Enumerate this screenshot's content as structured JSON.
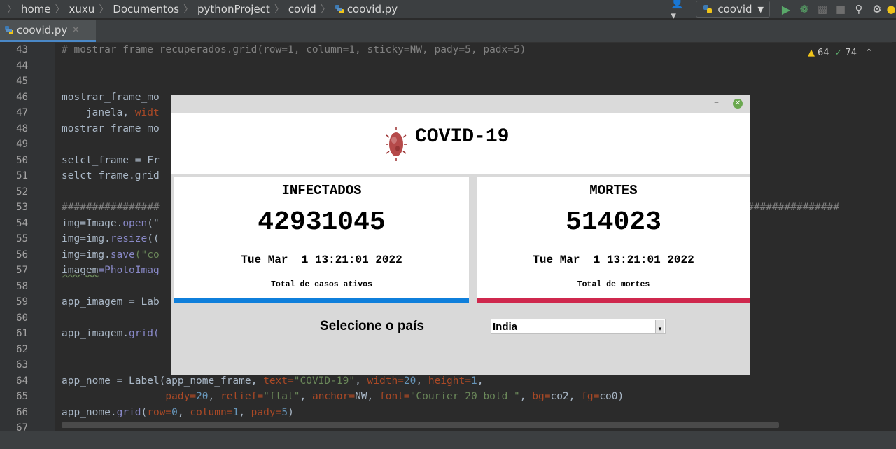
{
  "breadcrumb": [
    "home",
    "xuxu",
    "Documentos",
    "pythonProject",
    "covid",
    "coovid.py"
  ],
  "run_config": "coovid",
  "editor_tab": "coovid.py",
  "inspections": {
    "warnings": "64",
    "weak_warnings": "74"
  },
  "line_numbers": [
    "43",
    "44",
    "45",
    "46",
    "47",
    "48",
    "49",
    "50",
    "51",
    "52",
    "53",
    "54",
    "55",
    "56",
    "57",
    "58",
    "59",
    "60",
    "61",
    "62",
    "63",
    "64",
    "65",
    "66",
    "67"
  ],
  "code": {
    "l43": "# mostrar_frame_recuperados.grid(row=1, column=1, sticky=NW, pady=5, padx=5)",
    "l46": "mostrar_frame_mo",
    "l47a": "    janela, ",
    "l47b": "widt",
    "l48": "mostrar_frame_mo",
    "l50a": "selct_frame = ",
    "l50b": "Fr",
    "l51a": "selct_frame.",
    "l51b": "grid",
    "l53a": "################",
    "l53b": "###############",
    "l54a": "img=Image.",
    "l54b": "open",
    "l54c": "(\"",
    "l55a": "img=img.",
    "l55b": "resize",
    "l55c": "((",
    "l56a": "img=img.",
    "l56b": "save",
    "l56c": "(\"co",
    "l57a": "imagem",
    "l57b": "=PhotoImag",
    "l59": "app_imagem = Lab",
    "l61a": "app_imagem.",
    "l61b": "grid(",
    "l64a": "app_nome = Label(app_nome_frame, ",
    "l64b": "text=",
    "l64c": "\"COVID-19\"",
    "l64d": ", ",
    "l64e": "width=",
    "l64f": "20",
    "l64g": ", ",
    "l64h": "height=",
    "l64i": "1",
    "l64j": ",",
    "l65a": "                 ",
    "l65b": "pady=",
    "l65c": "20",
    "l65d": ", ",
    "l65e": "relief=",
    "l65f": "\"flat\"",
    "l65g": ", ",
    "l65h": "anchor=",
    "l65i": "NW, ",
    "l65j": "font=",
    "l65k": "\"Courier 20 bold \"",
    "l65l": ", ",
    "l65m": "bg=",
    "l65n": "co2, ",
    "l65o": "fg=",
    "l65p": "co0)",
    "l66a": "app_nome.",
    "l66b": "grid",
    "l66c": "(",
    "l66d": "row=",
    "l66e": "0",
    "l66f": ", ",
    "l66g": "column=",
    "l66h": "1",
    "l66i": ", ",
    "l66j": "pady=",
    "l66k": "5",
    "l66l": ")"
  },
  "app": {
    "title": "COVID-19",
    "infected": {
      "label": "INFECTADOS",
      "value": "42931045",
      "date": "Tue Mar  1 13:21:01 2022",
      "caption": "Total de casos ativos",
      "color": "#0f7fdb"
    },
    "deaths": {
      "label": "MORTES",
      "value": "514023",
      "date": "Tue Mar  1 13:21:01 2022",
      "caption": "Total de mortes",
      "color": "#cf284d"
    },
    "select_label": "Selecione o país",
    "selected_country": "India"
  }
}
